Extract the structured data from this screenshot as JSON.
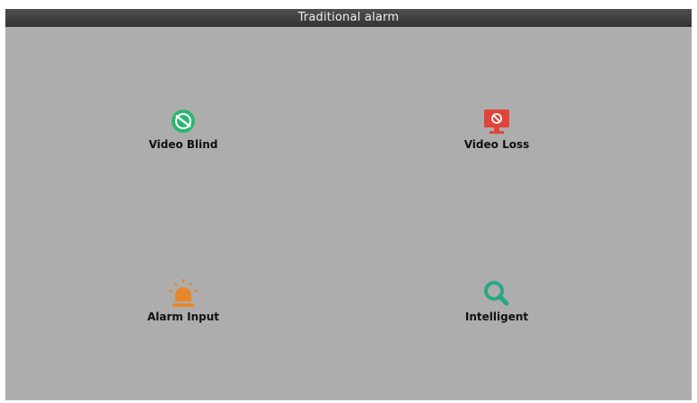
{
  "window": {
    "title": "Traditional alarm"
  },
  "menu": {
    "items": [
      {
        "label": "Video Blind",
        "icon": "video-blind-icon",
        "color": "#2bb673"
      },
      {
        "label": "Video Loss",
        "icon": "video-loss-icon",
        "color": "#e0453c"
      },
      {
        "label": "Alarm Input",
        "icon": "alarm-light-icon",
        "color": "#e8872a"
      },
      {
        "label": "Intelligent",
        "icon": "magnifier-icon",
        "color": "#27a884"
      }
    ]
  }
}
